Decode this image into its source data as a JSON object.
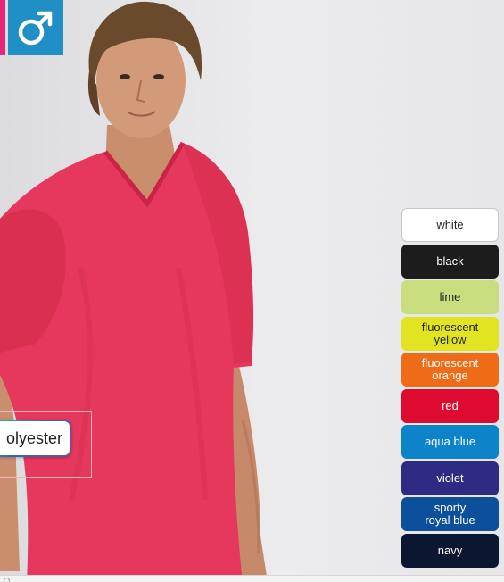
{
  "product": {
    "gender_icon": "male-symbol-icon",
    "gender_symbol": "♂",
    "material_label": "olyester"
  },
  "colors": {
    "accent_pink": "#e5277e",
    "accent_blue": "#1f8fc6",
    "shirt": "#e6375c"
  },
  "swatches": [
    {
      "label": "white",
      "bg": "#ffffff",
      "fg": "#222222"
    },
    {
      "label": "black",
      "bg": "#1c1c1c",
      "fg": "#ffffff"
    },
    {
      "label": "lime",
      "bg": "#c7dd7e",
      "fg": "#222222"
    },
    {
      "label": "fluorescent\nyellow",
      "bg": "#e3e421",
      "fg": "#222222"
    },
    {
      "label": "fluorescent\norange",
      "bg": "#ee6b17",
      "fg": "#ffffff"
    },
    {
      "label": "red",
      "bg": "#de0a2f",
      "fg": "#ffffff"
    },
    {
      "label": "aqua blue",
      "bg": "#0d83c9",
      "fg": "#ffffff"
    },
    {
      "label": "violet",
      "bg": "#2f2a83",
      "fg": "#ffffff"
    },
    {
      "label": "sporty\nroyal blue",
      "bg": "#0c4f9a",
      "fg": "#ffffff"
    },
    {
      "label": "navy",
      "bg": "#0b1630",
      "fg": "#ffffff"
    }
  ]
}
